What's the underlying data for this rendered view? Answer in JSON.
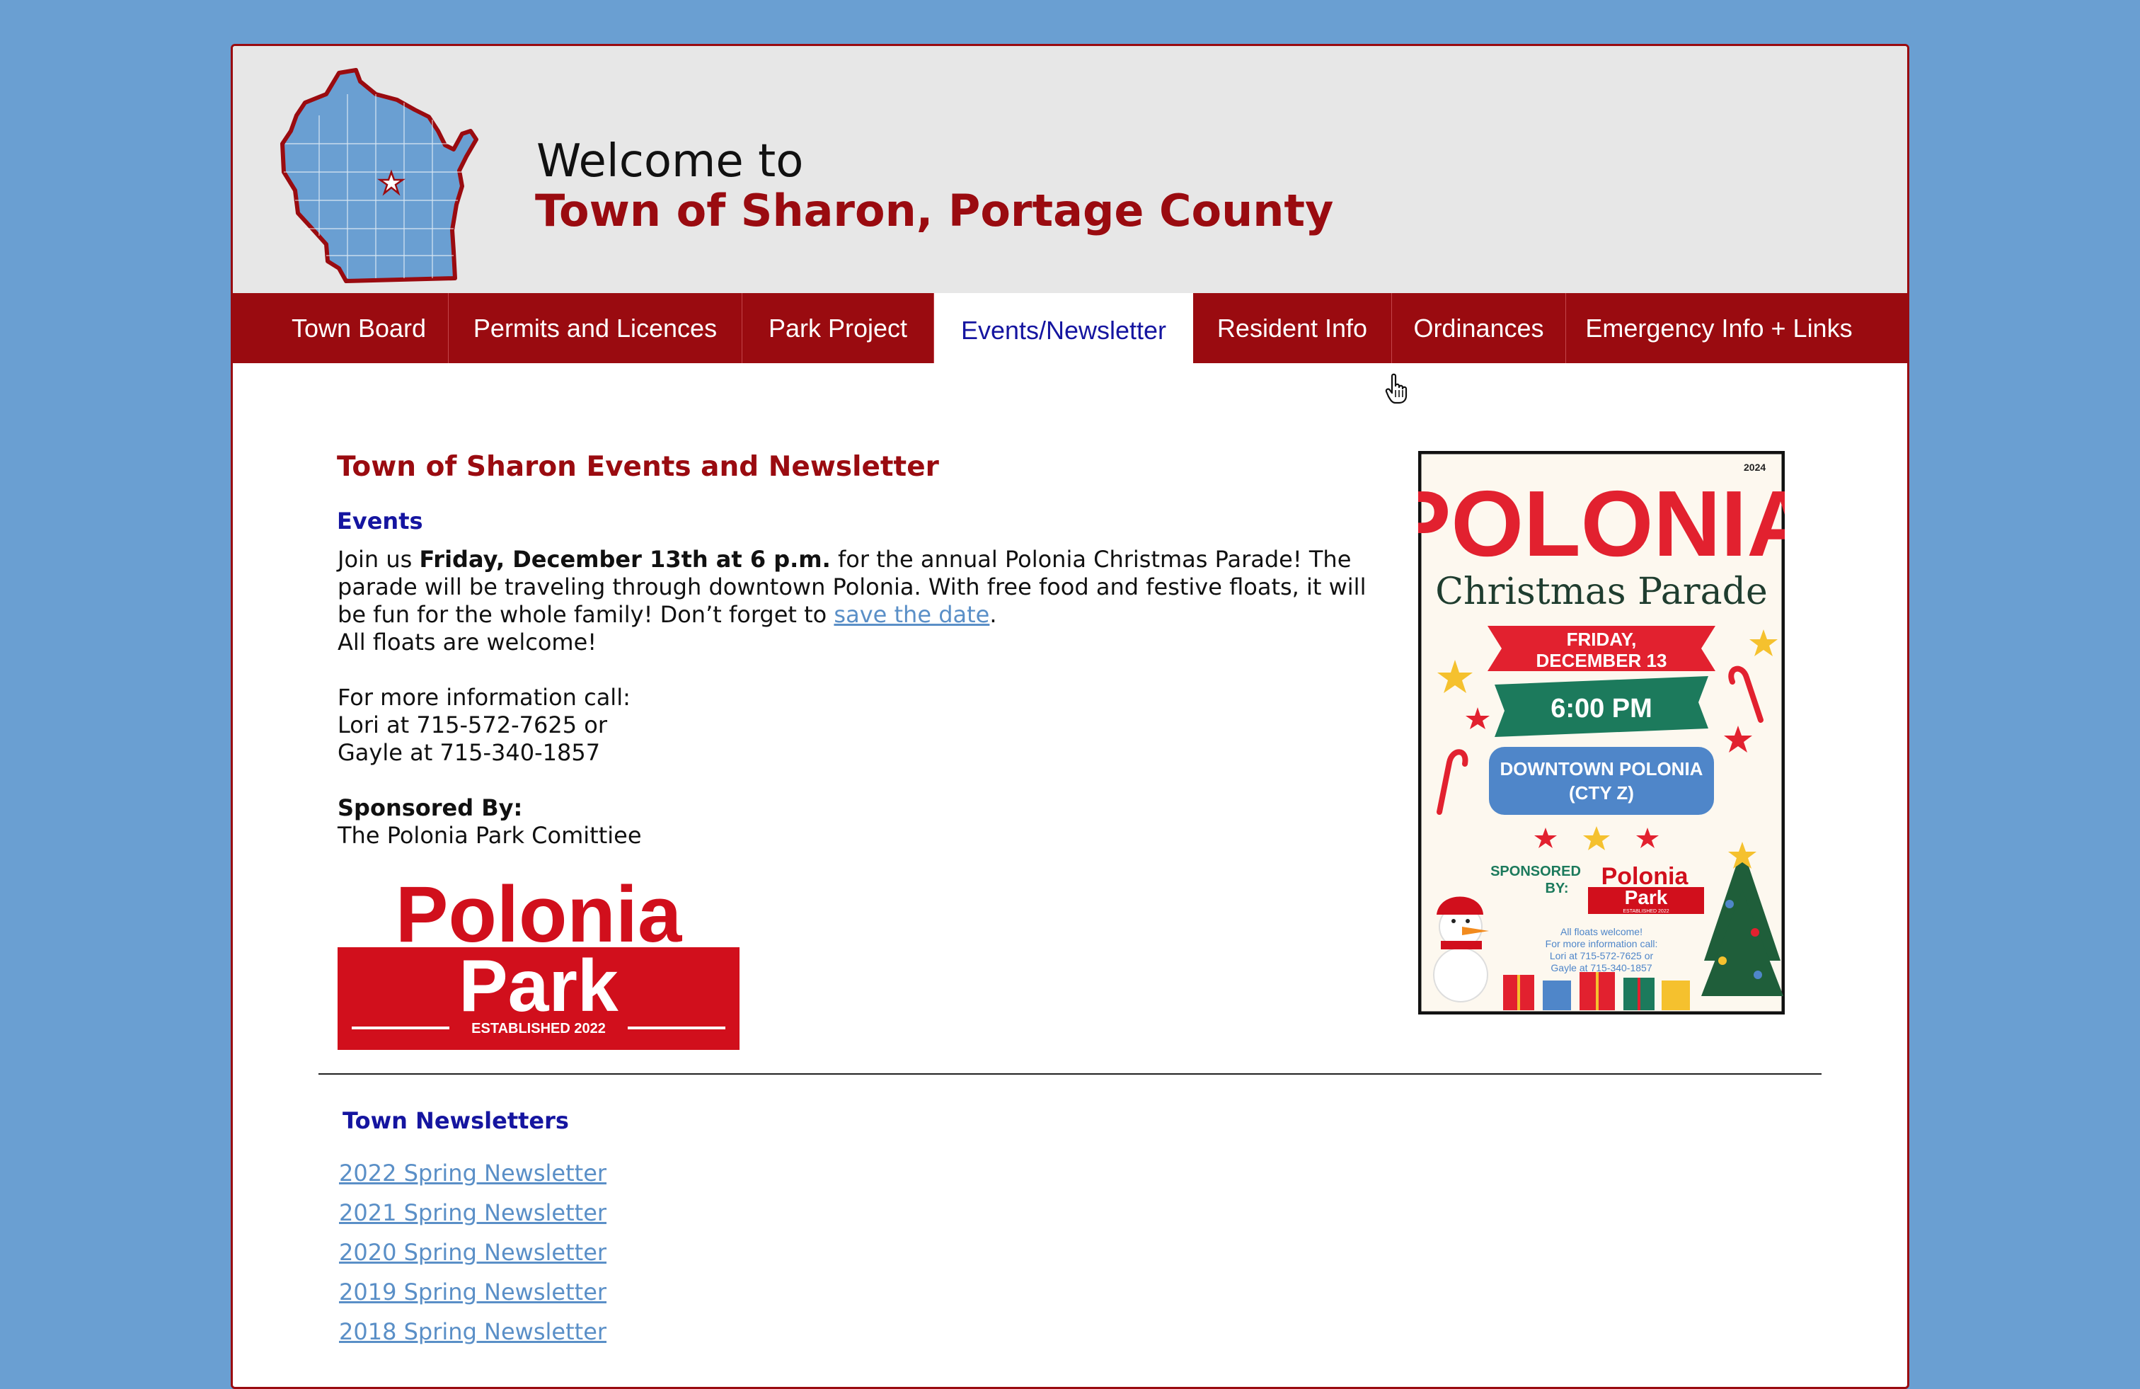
{
  "header": {
    "welcome": "Welcome to",
    "title": "Town of Sharon, Portage County",
    "logo_icon": "wisconsin-map-icon"
  },
  "nav": {
    "items": [
      {
        "label": "Town Board"
      },
      {
        "label": "Permits and Licences"
      },
      {
        "label": "Park Project"
      },
      {
        "label": "Events/Newsletter",
        "active": true
      },
      {
        "label": "Resident Info"
      },
      {
        "label": "Ordinances"
      },
      {
        "label": "Emergency Info + Links"
      }
    ]
  },
  "main": {
    "page_title": "Town of Sharon Events and Newsletter",
    "events_heading": "Events",
    "events": {
      "intro_pre": "Join us ",
      "intro_bold": "Friday, December 13th at 6 p.m.",
      "intro_post": " for the annual Polonia Christmas Parade! The parade will be traveling through downtown Polonia. With free food and festive floats, it will be fun for the whole family! Don’t forget to ",
      "save_date_link": "save the date",
      "intro_end": ".",
      "floats": "All floats are welcome!",
      "info_call": "For more information call:",
      "contact_1": "Lori at 715-572-7625 or",
      "contact_2": "Gayle at 715-340-1857",
      "sponsored_label": "Sponsored By:",
      "sponsor": "The Polonia Park Comittiee"
    },
    "park_logo": {
      "line1": "Polonia",
      "line2": "Park",
      "tagline": "ESTABLISHED 2022"
    },
    "poster": {
      "year": "2024",
      "title": "POLONIA",
      "subtitle": "Christmas Parade",
      "date_line1": "FRIDAY,",
      "date_line2": "DECEMBER 13",
      "time": "6:00 PM",
      "location_line1": "DOWNTOWN POLONIA",
      "location_line2": "(CTY Z)",
      "sponsored_line1": "SPONSORED",
      "sponsored_line2": "BY:",
      "logo_line1": "Polonia",
      "logo_line2": "Park",
      "logo_tag": "ESTABLISHED 2022",
      "info1": "All floats welcome!",
      "info2": "For more information call:",
      "info3": "Lori at 715-572-7625 or",
      "info4": "Gayle at 715-340-1857"
    },
    "newsletters_heading": "Town Newsletters",
    "newsletters": [
      {
        "label": "2022 Spring Newsletter "
      },
      {
        "label": "2021 Spring Newsletter "
      },
      {
        "label": "2020 Spring Newsletter "
      },
      {
        "label": "2019 Spring Newsletter"
      },
      {
        "label": "2018 Spring Newsletter"
      }
    ]
  },
  "colors": {
    "background": "#6a9fd2",
    "brand_red": "#9a0b10",
    "heading_blue": "#1515a0",
    "link_blue": "#5a8fc7"
  }
}
